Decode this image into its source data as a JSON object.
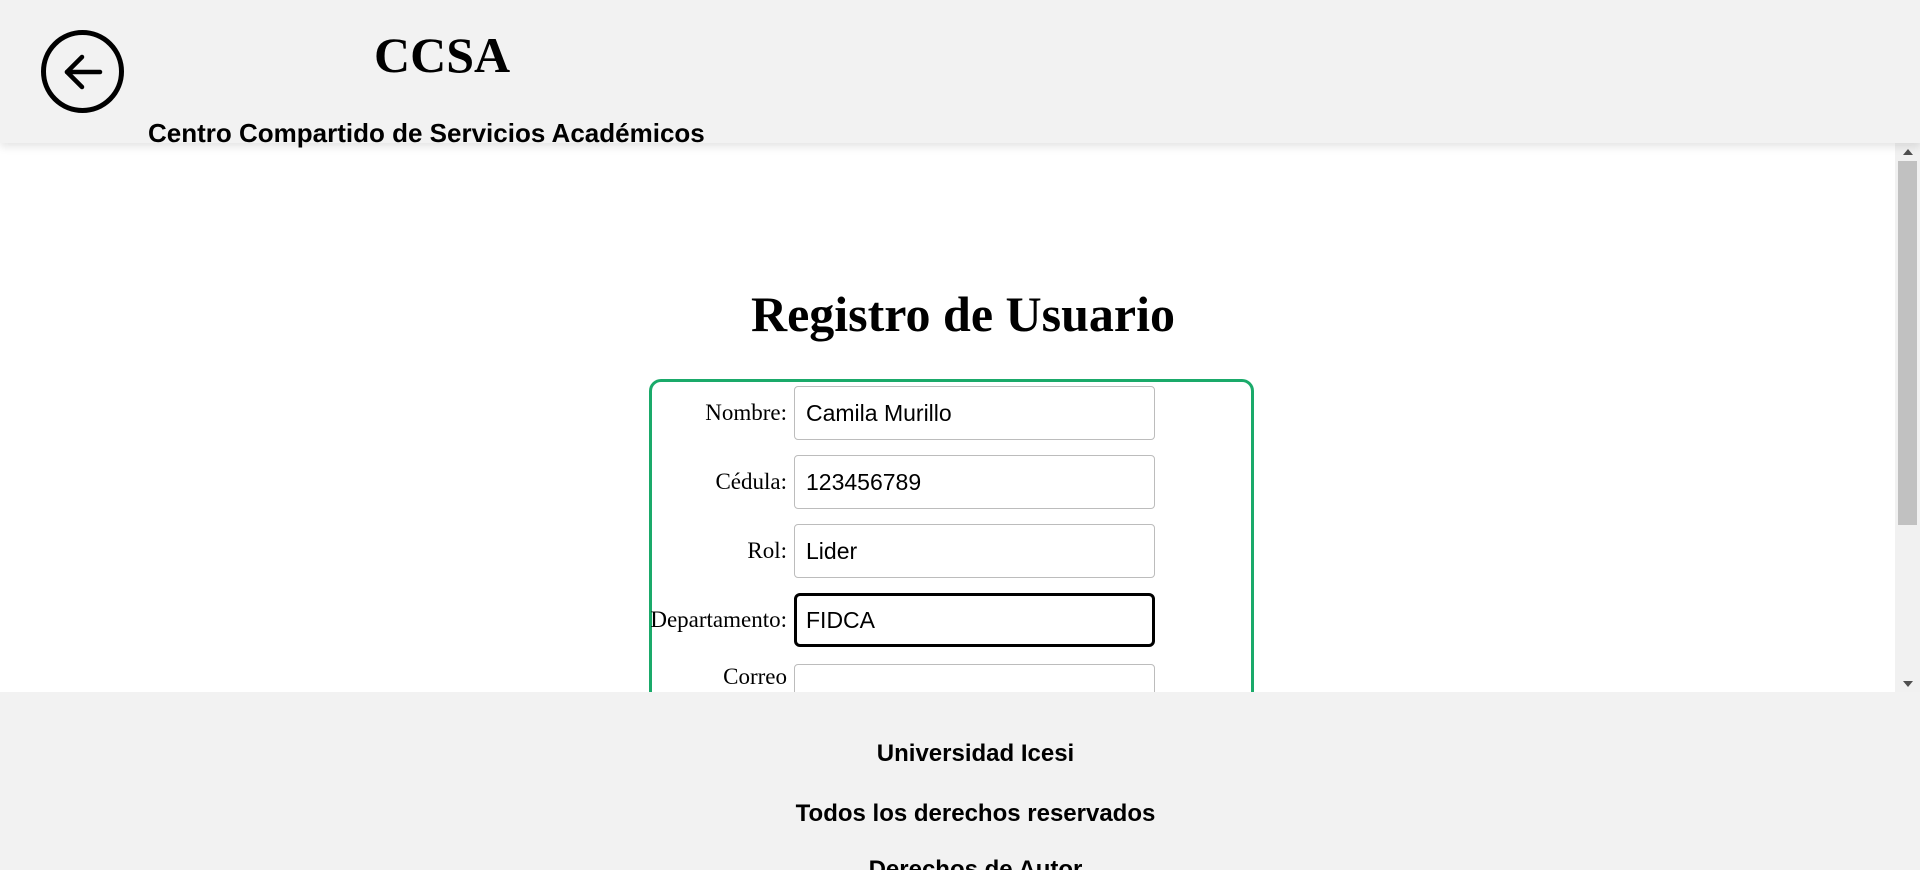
{
  "header": {
    "back_icon": "arrow-left-icon",
    "title": "CCSA",
    "subtitle": "Centro Compartido de Servicios Académicos"
  },
  "main": {
    "title": "Registro de Usuario",
    "form": {
      "accent_color": "#1aaa6a",
      "fields": [
        {
          "label": "Nombre:",
          "value": "Camila Murillo"
        },
        {
          "label": "Cédula:",
          "value": "123456789"
        },
        {
          "label": "Rol:",
          "value": "Lider"
        },
        {
          "label": "Departamento:",
          "value": "FIDCA"
        },
        {
          "label": "Correo Electronico:",
          "value": ""
        }
      ]
    }
  },
  "footer": {
    "lines": [
      "Universidad Icesi",
      "Todos los derechos reservados",
      "Derechos de Autor"
    ]
  }
}
